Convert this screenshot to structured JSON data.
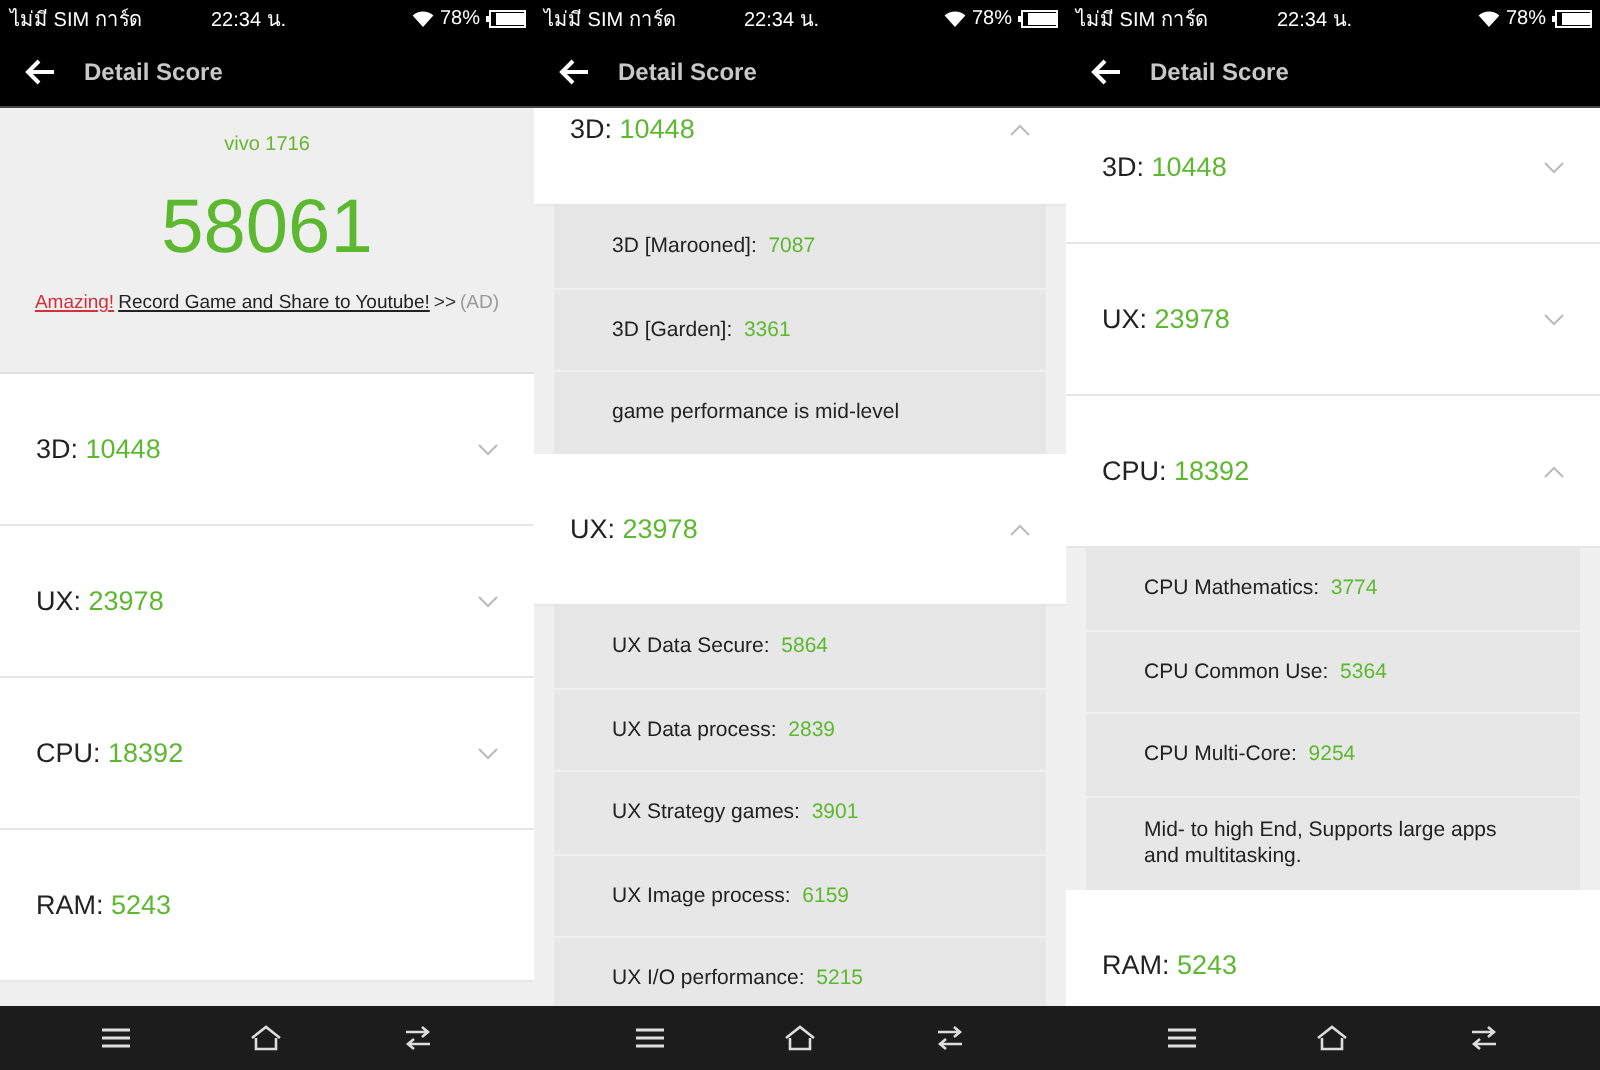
{
  "phones": [
    {
      "status_bar": {
        "carrier": "ไม่มี SIM การ์ด",
        "time": "22:34 น.",
        "battery": "78%"
      },
      "title": "Detail Score",
      "summary": {
        "device": "vivo 1716",
        "score": "58061",
        "ad": {
          "highlight": "Amazing!",
          "link": "Record Game and Share to Youtube!",
          "arrows": ">>",
          "tag": "(AD)"
        }
      },
      "sections": [
        {
          "kind": "expandable",
          "label": "3D:",
          "score": "10448",
          "expanded": false
        },
        {
          "kind": "expandable",
          "label": "UX:",
          "score": "23978",
          "expanded": false
        },
        {
          "kind": "expandable",
          "label": "CPU:",
          "score": "18392",
          "expanded": false
        },
        {
          "kind": "plain",
          "label": "RAM:",
          "score": "5243"
        }
      ]
    },
    {
      "status_bar": {
        "carrier": "ไม่มี SIM การ์ด",
        "time": "22:34 น.",
        "battery": "78%"
      },
      "title": "Detail Score",
      "sections": [
        {
          "kind": "expandable",
          "label": "3D:",
          "score": "10448",
          "expanded": true,
          "items": [
            {
              "label": "3D [Marooned]:",
              "score": "7087"
            },
            {
              "label": "3D [Garden]:",
              "score": "3361"
            }
          ],
          "note": "game performance is mid-level"
        },
        {
          "kind": "expandable",
          "label": "UX:",
          "score": "23978",
          "expanded": true,
          "items": [
            {
              "label": "UX Data Secure:",
              "score": "5864"
            },
            {
              "label": "UX Data process:",
              "score": "2839"
            },
            {
              "label": "UX Strategy games:",
              "score": "3901"
            },
            {
              "label": "UX Image process:",
              "score": "6159"
            },
            {
              "label": "UX I/O performance:",
              "score": "5215"
            }
          ]
        }
      ]
    },
    {
      "status_bar": {
        "carrier": "ไม่มี SIM การ์ด",
        "time": "22:34 น.",
        "battery": "78%"
      },
      "title": "Detail Score",
      "sections": [
        {
          "kind": "expandable",
          "label": "3D:",
          "score": "10448",
          "expanded": false
        },
        {
          "kind": "expandable",
          "label": "UX:",
          "score": "23978",
          "expanded": false
        },
        {
          "kind": "expandable",
          "label": "CPU:",
          "score": "18392",
          "expanded": true,
          "items": [
            {
              "label": "CPU Mathematics:",
              "score": "3774"
            },
            {
              "label": "CPU Common Use:",
              "score": "5364"
            },
            {
              "label": "CPU Multi-Core:",
              "score": "9254"
            }
          ],
          "note": "Mid- to high End, Supports large apps and multitasking."
        },
        {
          "kind": "plain",
          "label": "RAM:",
          "score": "5243"
        }
      ]
    }
  ]
}
